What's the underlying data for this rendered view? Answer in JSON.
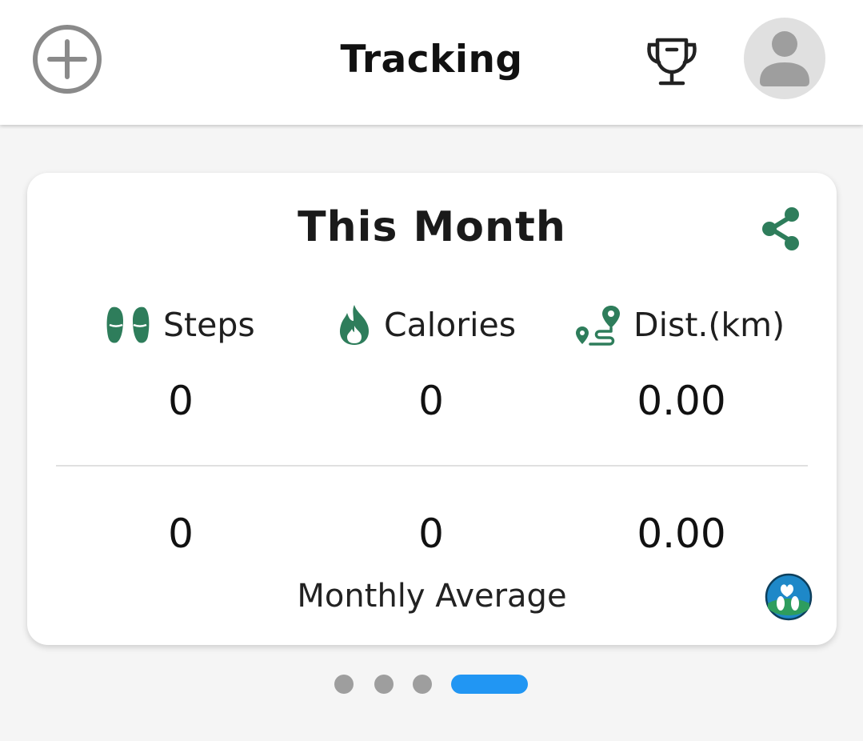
{
  "header": {
    "title": "Tracking",
    "add_icon": "plus-circle-icon",
    "trophy_icon": "trophy-icon",
    "avatar_icon": "person-icon"
  },
  "card": {
    "title": "This Month",
    "share_icon": "share-icon",
    "accent_color": "#2e7d5b",
    "metrics": [
      {
        "label": "Steps",
        "icon": "footprints-icon"
      },
      {
        "label": "Calories",
        "icon": "flame-icon"
      },
      {
        "label": "Dist.(km)",
        "icon": "route-icon"
      }
    ],
    "totals": [
      "0",
      "0",
      "0.00"
    ],
    "averages": [
      "0",
      "0",
      "0.00"
    ],
    "average_label": "Monthly Average",
    "logo_icon": "app-logo-icon"
  },
  "pager": {
    "count": 4,
    "active_index": 3,
    "active_color": "#2196f3",
    "inactive_color": "#9e9e9e"
  }
}
